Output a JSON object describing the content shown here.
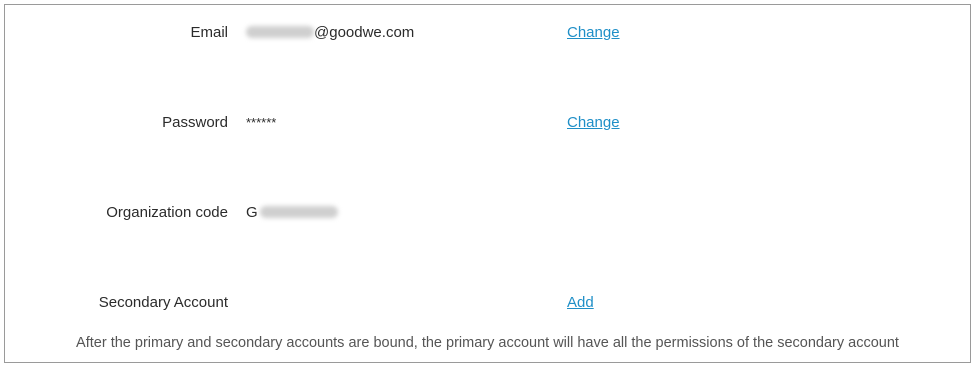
{
  "account": {
    "email": {
      "label": "Email",
      "value_suffix": "@goodwe.com",
      "action": "Change"
    },
    "password": {
      "label": "Password",
      "value": "******",
      "action": "Change"
    },
    "organization_code": {
      "label": "Organization code",
      "value_prefix": "G"
    },
    "secondary_account": {
      "label": "Secondary Account",
      "action": "Add"
    },
    "note": "After the primary and secondary accounts are bound, the primary account will have all the permissions of the secondary account"
  },
  "colors": {
    "link": "#1f8fc7",
    "label_text": "#2b2b2b",
    "note_text": "#555555",
    "border": "#9a9a9a"
  }
}
